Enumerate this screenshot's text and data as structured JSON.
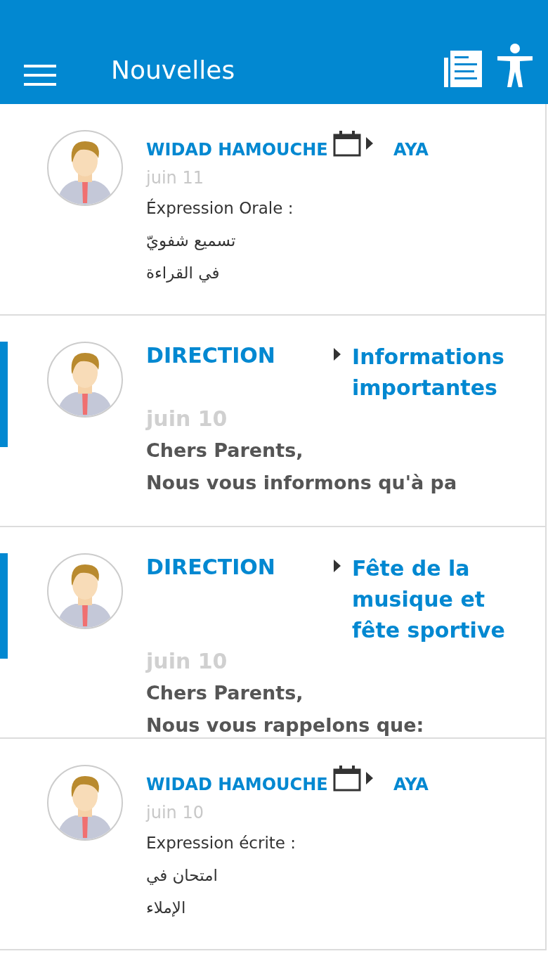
{
  "app_bar": {
    "title": "Nouvelles"
  },
  "items": [
    {
      "kind": "homework",
      "unread": false,
      "sender": "WIDAD HAMOUCHE",
      "target": "AYA",
      "date": "juin 11",
      "lines": [
        "Éxpression Orale :",
        "تسميع شفويّ",
        "في القراءة"
      ]
    },
    {
      "kind": "news",
      "unread": true,
      "sender": "DIRECTION",
      "target": "Informations importantes",
      "date": "juin 10",
      "lines": [
        "Chers Parents,",
        "Nous vous informons qu'à pa"
      ]
    },
    {
      "kind": "news",
      "unread": true,
      "sender": "DIRECTION",
      "target": "Fête de la musique et fête sportive",
      "date": "juin 10",
      "lines": [
        "Chers Parents,",
        "Nous vous rappelons que:"
      ]
    },
    {
      "kind": "homework",
      "unread": false,
      "sender": "WIDAD HAMOUCHE",
      "target": "AYA",
      "date": "juin 10",
      "lines": [
        "Expression écrite :",
        "امتحان في",
        "الإملاء"
      ]
    }
  ]
}
